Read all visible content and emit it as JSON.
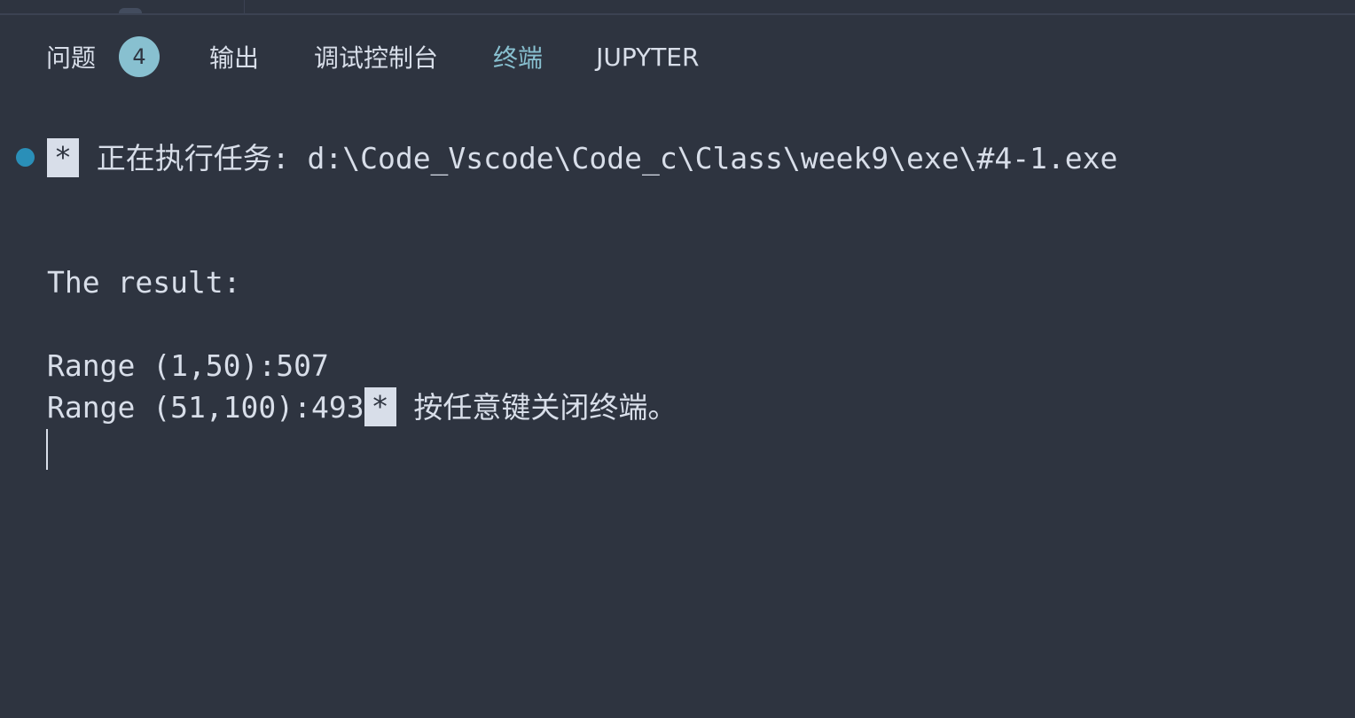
{
  "tabs": [
    {
      "label": "问题",
      "badge": "4"
    },
    {
      "label": "输出"
    },
    {
      "label": "调试控制台"
    },
    {
      "label": "终端",
      "active": true
    },
    {
      "label": "JUPYTER"
    }
  ],
  "terminal": {
    "task_marker": "*",
    "task_text": "正在执行任务: d:\\Code_Vscode\\Code_c\\Class\\week9\\exe\\#4-1.exe",
    "result_header": "The result:",
    "range1": "Range (1,50):507",
    "range2": "Range (51,100):493",
    "close_marker": "*",
    "close_text": "按任意键关闭终端。"
  },
  "colors": {
    "background": "#2e3440",
    "foreground": "#d8dee9",
    "accent": "#88c0d0",
    "status_dot": "#2a8fb8"
  }
}
